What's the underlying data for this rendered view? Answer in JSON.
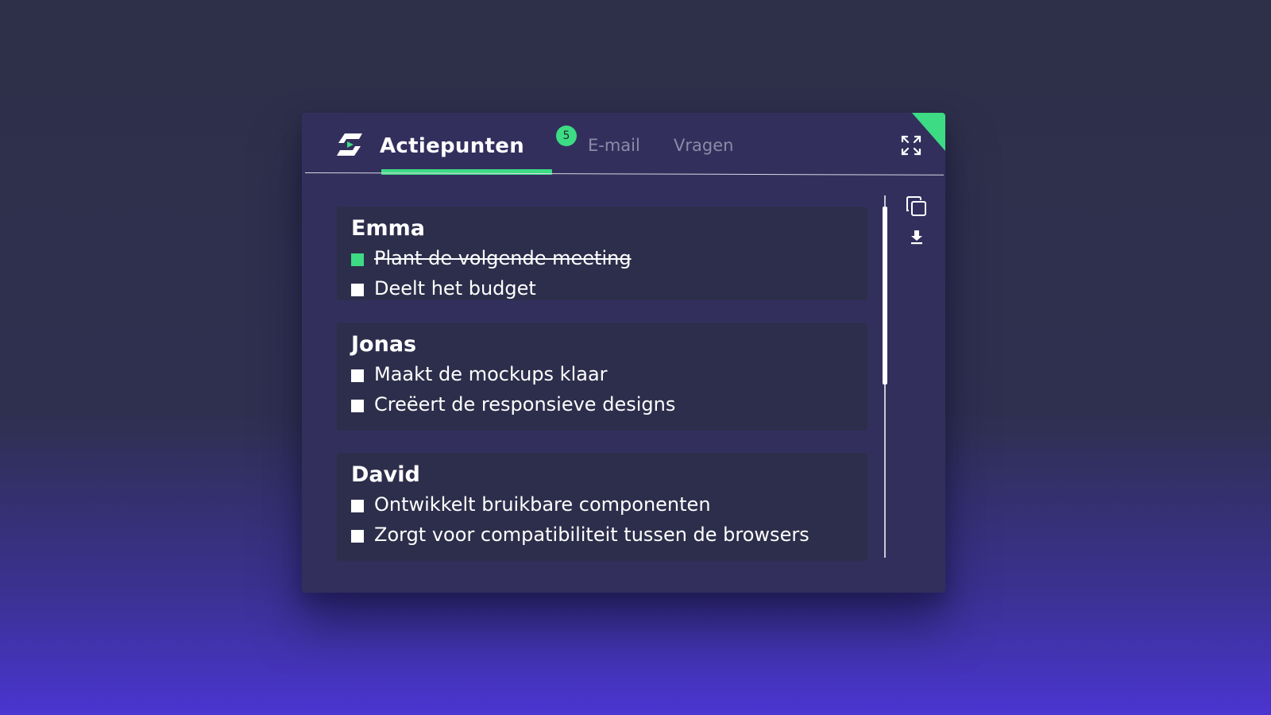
{
  "header": {
    "active_tab": "Actiepunten",
    "tabs": [
      {
        "label": "E-mail",
        "badge": "5"
      },
      {
        "label": "Vragen"
      }
    ]
  },
  "icons": {
    "logo": "app-logo-icon",
    "expand": "expand-icon",
    "copy": "copy-icon",
    "download": "download-icon"
  },
  "colors": {
    "accent": "#3ddc84",
    "panel": "#332f5d",
    "card": "#2d2e4b"
  },
  "groups": [
    {
      "name": "Emma",
      "items": [
        {
          "label": "Plant de volgende meeting",
          "done": true
        },
        {
          "label": "Deelt het budget",
          "done": false
        }
      ]
    },
    {
      "name": "Jonas",
      "items": [
        {
          "label": "Maakt de mockups klaar",
          "done": false
        },
        {
          "label": "Creëert de responsieve designs",
          "done": false
        }
      ]
    },
    {
      "name": "David",
      "items": [
        {
          "label": "Ontwikkelt bruikbare componenten",
          "done": false
        },
        {
          "label": "Zorgt voor compatibiliteit tussen de browsers",
          "done": false
        }
      ]
    }
  ]
}
